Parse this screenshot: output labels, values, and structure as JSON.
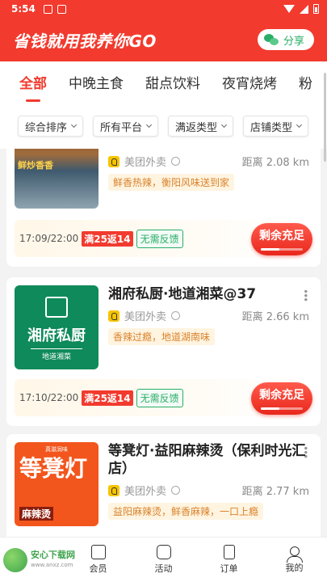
{
  "status": {
    "time": "5:54"
  },
  "header": {
    "title": "省钱就用我养你GO",
    "share_label": "分享"
  },
  "tabs": [
    {
      "label": "全部",
      "active": true
    },
    {
      "label": "中晚主食"
    },
    {
      "label": "甜点饮料"
    },
    {
      "label": "夜宵烧烤"
    },
    {
      "label": "粉"
    }
  ],
  "filters": [
    {
      "label": "综合排序"
    },
    {
      "label": "所有平台"
    },
    {
      "label": "满返类型"
    },
    {
      "label": "店铺类型"
    }
  ],
  "stores": [
    {
      "name": "",
      "platform": "美团外卖",
      "distance": "距离 2.08 km",
      "desc": "鲜香热辣，衡阳风味送到家",
      "time": "17:09/22:00",
      "promo": "满25返14",
      "tag": "无需反馈",
      "button": "剩余充足",
      "remaining": 0.45,
      "thumb_text": "鲜炒香香"
    },
    {
      "name": "湘府私厨·地道湘菜@37",
      "platform": "美团外卖",
      "distance": "距离 2.66 km",
      "desc": "香辣过瘾，地道湖南味",
      "time": "17:10/22:00",
      "promo": "满25返14",
      "tag": "无需反馈",
      "button": "剩余充足",
      "remaining": 0.45,
      "thumb_text": "湘府私厨",
      "thumb_sub": "地道湘菜"
    },
    {
      "name": "等凳灯·益阳麻辣烫（保利时光汇店）",
      "platform": "美团外卖",
      "distance": "距离 2.77 km",
      "desc": "益阳麻辣烫，鲜香麻辣，一口上瘾",
      "thumb_text": "等凳灯",
      "thumb_sub": "麻辣烫",
      "thumb_top": "真滋润味"
    }
  ],
  "bottom_nav": [
    {
      "label": "会员",
      "icon": "vip-icon"
    },
    {
      "label": "活动",
      "icon": "star-icon"
    },
    {
      "label": "订单",
      "icon": "order-icon"
    },
    {
      "label": "我的",
      "icon": "user-icon"
    }
  ],
  "watermark": {
    "text": "安心下载网",
    "sub": "www.anxz.com"
  },
  "colors": {
    "primary": "#f23a2e",
    "green": "#2aae67",
    "orange": "#d9822b"
  }
}
